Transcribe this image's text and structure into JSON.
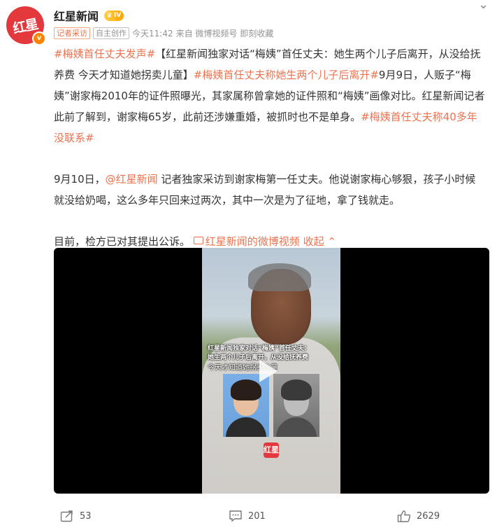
{
  "header": {
    "avatar_text": "红星",
    "username": "红星新闻",
    "vip_badge": "IV",
    "tags": [
      "记者采访",
      "自主创作"
    ],
    "time": "今天11:42",
    "source": "来自 微博视频号",
    "read_later": "即刻收藏"
  },
  "post": {
    "para1": [
      {
        "type": "link",
        "text": "#梅姨首任丈夫发声#"
      },
      {
        "type": "text",
        "text": "【红星新闻独家对话“梅姨”首任丈夫：她生两个儿子后离开，从没给抚养费 今天才知道她拐卖儿童】"
      },
      {
        "type": "link",
        "text": "#梅姨首任丈夫称她生两个儿子后离开#"
      },
      {
        "type": "text",
        "text": "9月9日，人贩子“梅姨”谢家梅2010年的证件照曝光，其家属称曾拿她的证件照和“梅姨”画像对比。红星新闻记者此前了解到，谢家梅65岁，此前还涉嫌重婚，被抓时也不是单身。"
      },
      {
        "type": "link",
        "text": "#梅姨首任丈夫称40多年没联系#"
      }
    ],
    "para2": [
      {
        "type": "text",
        "text": "9月10日，"
      },
      {
        "type": "link",
        "text": "@红星新闻"
      },
      {
        "type": "text",
        "text": " 记者独家采访到谢家梅第一任丈夫。他说谢家梅心够狠，孩子小时候就没给奶喝，这么多年只回来过两次，其中一次是为了征地，拿了钱就走。"
      }
    ],
    "para3_text": "目前，检方已对其提出公诉。 ",
    "video_link": "红星新闻的微博视频",
    "collapse": "收起"
  },
  "video": {
    "caption_line1": "红星新闻独家对话“梅姨”首任丈夫：",
    "caption_line2": "她生两个儿子后离开，从没给抚养费",
    "caption_line3": "今天才知道她拐卖儿童",
    "logo": "红星"
  },
  "actions": {
    "repost_count": "53",
    "comment_count": "201",
    "like_count": "2629"
  },
  "colors": {
    "link": "#eb7350",
    "brand": "#e4393c"
  }
}
